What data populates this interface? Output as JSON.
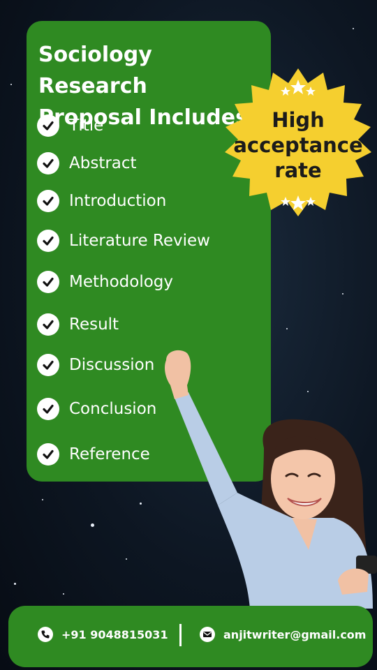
{
  "card": {
    "title_line1": "Sociology Research",
    "title_line2": "Proposal Includes",
    "items": [
      "Title",
      "Abstract",
      "Introduction",
      "Literature Review",
      "Methodology",
      "Result",
      "Discussion",
      "Conclusion",
      "Reference"
    ]
  },
  "badge": {
    "line1": "High",
    "line2": "acceptance",
    "line3": "rate"
  },
  "footer": {
    "phone": "+91 9048815031",
    "email": "anjitwriter@gmail.com"
  },
  "colors": {
    "card_green": "#2f8a22",
    "badge_yellow": "#f5cf2f",
    "text_white": "#ffffff"
  },
  "icons": [
    "check-icon",
    "star-icon",
    "phone-icon",
    "mail-icon"
  ]
}
